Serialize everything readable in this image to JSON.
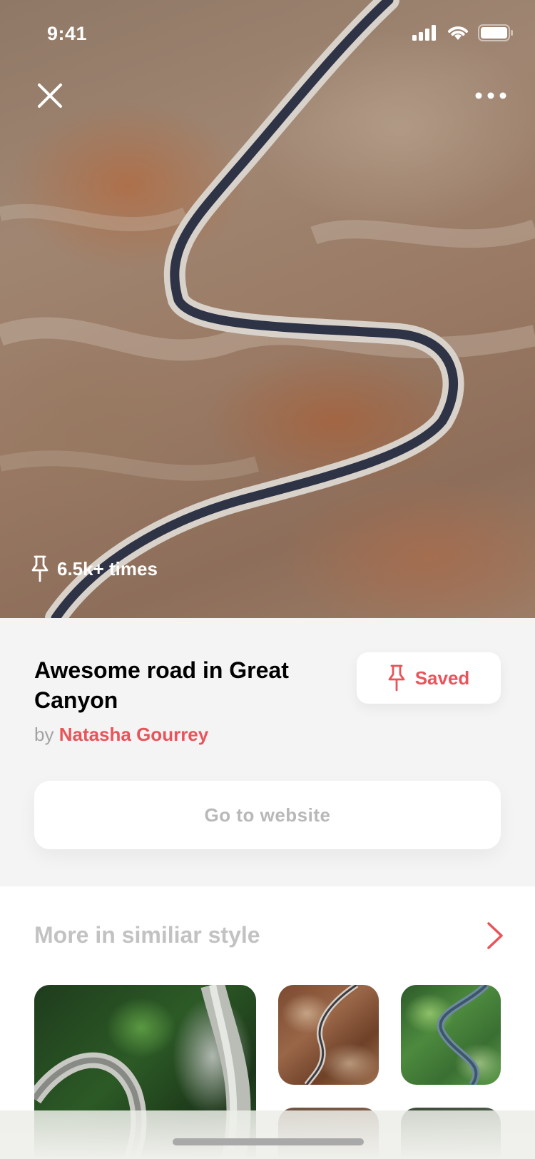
{
  "status_bar": {
    "time": "9:41"
  },
  "hero": {
    "pin_count": "6.5k+ times",
    "close_icon": "close-icon",
    "more_icon": "more-horizontal-icon"
  },
  "detail": {
    "title": "Awesome road in Great Canyon",
    "by_prefix": "by",
    "author": "Natasha Gourrey",
    "saved_label": "Saved",
    "website_label": "Go to website"
  },
  "similar": {
    "title": "More in similiar style",
    "arrow_icon": "chevron-right-icon"
  },
  "colors": {
    "accent": "#e8545a",
    "muted_text": "#a3a3a3",
    "button_text_disabled": "#b8b8b8",
    "section_bg": "#f4f4f4"
  }
}
